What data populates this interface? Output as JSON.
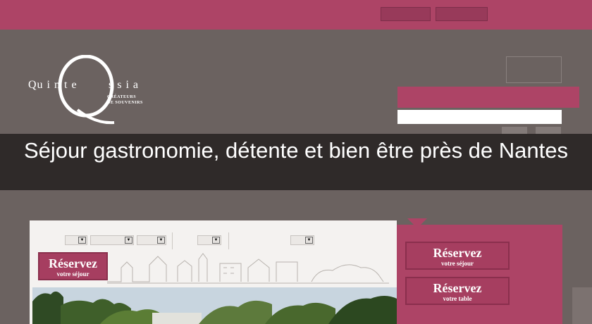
{
  "header": {
    "colors": {
      "bar": "#ad4466",
      "button": "#983a5a"
    }
  },
  "logo": {
    "left_letters": "Qu i n t e",
    "right_letters": "s s i a",
    "line1": "CRÉATEURS",
    "line2": "DE SOUVENIRS",
    "aria": "Quintessia Créateurs de souvenirs"
  },
  "banner": {
    "title": "Séjour gastronomie, détente et bien être près de Nantes"
  },
  "booking": {
    "reserve_label": "Réservez",
    "reserve_sub": "votre séjour",
    "dropdown_arrow": "▼"
  },
  "side": {
    "buttons": [
      {
        "label": "Réservez",
        "sub": "votre séjour"
      },
      {
        "label": "Réservez",
        "sub": "votre table"
      }
    ]
  },
  "icons": {
    "dropdown": "chevron-down-icon"
  }
}
